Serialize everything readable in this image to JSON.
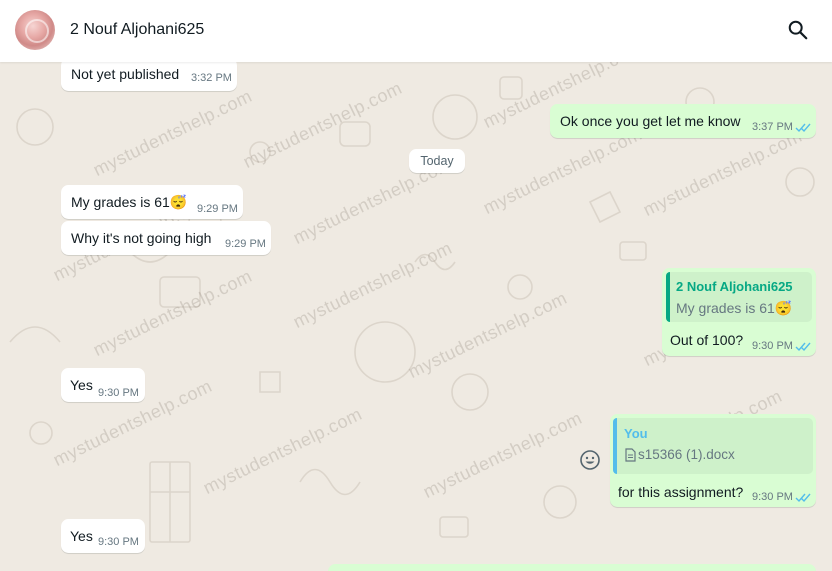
{
  "header": {
    "contact_name": "2 Nouf Aljohani625",
    "avatar_icon": "avatar-rose-photo",
    "search_icon": "search-icon"
  },
  "date_divider": "Today",
  "watermark": "mystudentshelp.com",
  "messages": [
    {
      "direction": "in",
      "text": "Not yet published",
      "time": "3:32 PM"
    },
    {
      "direction": "out",
      "text": "Ok once you get let me know",
      "time": "3:37 PM",
      "status": "read"
    },
    {
      "direction": "in",
      "text": "My grades is 61",
      "emoji": "😴",
      "time": "9:29 PM"
    },
    {
      "direction": "in",
      "text": "Why it's not going high",
      "time": "9:29 PM"
    },
    {
      "direction": "out",
      "quote_author": "2 Nouf Aljohani625",
      "quote_text": "My grades is 61",
      "quote_emoji": "😴",
      "text": "Out of 100?",
      "time": "9:30 PM",
      "status": "read"
    },
    {
      "direction": "in",
      "text": "Yes",
      "time": "9:30 PM"
    },
    {
      "direction": "out",
      "quote_author": "You",
      "quote_file": "s15366 (1).docx",
      "text": "for this assignment?",
      "time": "9:30 PM",
      "status": "read"
    },
    {
      "direction": "in",
      "text": "Yes",
      "time": "9:30 PM"
    }
  ],
  "colors": {
    "outgoing_bubble": "#d9fdd3",
    "incoming_bubble": "#ffffff",
    "chat_background": "#efeae2",
    "read_ticks": "#53bdeb",
    "quote_author_contact": "#06a884",
    "quote_author_you": "#53bdeb"
  }
}
